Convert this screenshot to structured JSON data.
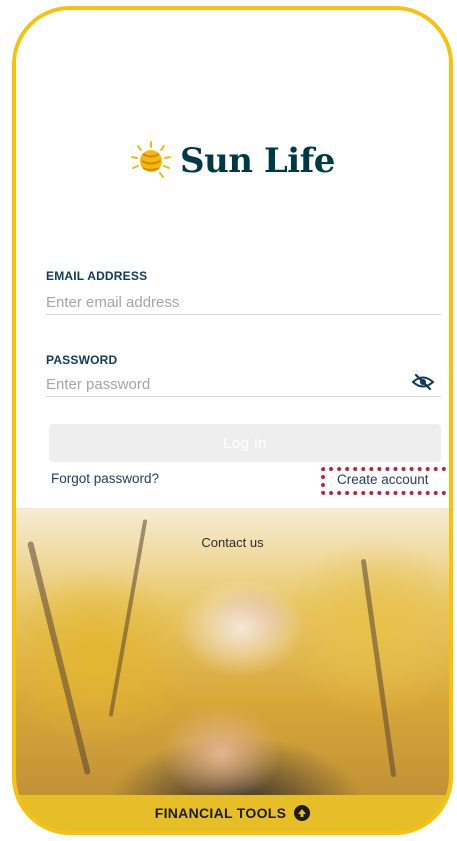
{
  "brand": {
    "name": "Sun Life",
    "accent_color": "#f6c20d",
    "text_color": "#003946",
    "logo_icon": "sun-logo-icon"
  },
  "form": {
    "email": {
      "label": "EMAIL ADDRESS",
      "placeholder": "Enter email address",
      "value": ""
    },
    "password": {
      "label": "PASSWORD",
      "placeholder": "Enter password",
      "value": "",
      "toggle_icon": "eye-slash-icon"
    },
    "login_label": "Log in"
  },
  "links": {
    "forgot_password": "Forgot password?",
    "create_account": "Create account",
    "contact_us": "Contact us"
  },
  "footer": {
    "label": "FINANCIAL TOOLS",
    "icon": "arrow-up-circle-icon"
  }
}
